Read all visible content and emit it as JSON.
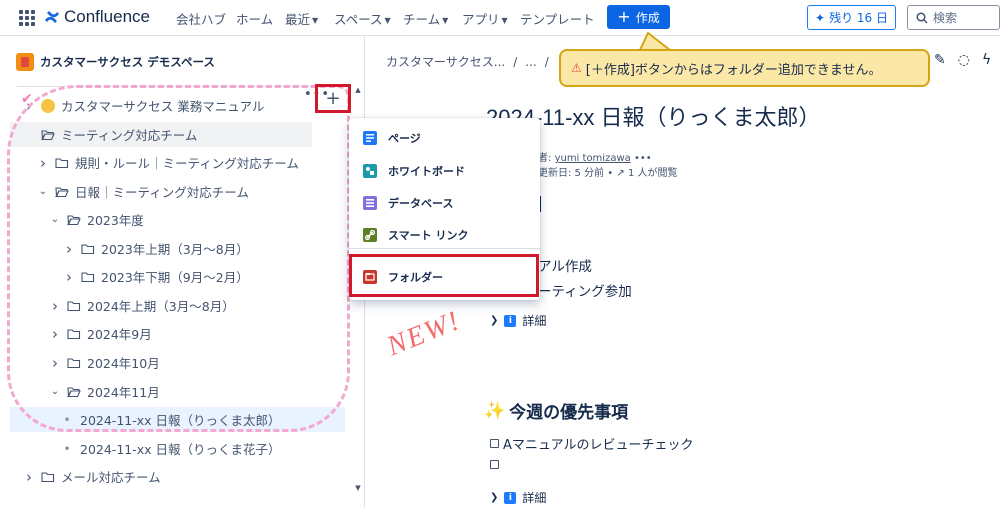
{
  "topnav": {
    "brand": "Confluence",
    "items": [
      {
        "label": "会社ハブ",
        "has_chevron": false
      },
      {
        "label": "ホーム",
        "has_chevron": false
      },
      {
        "label": "最近",
        "has_chevron": true
      },
      {
        "label": "スペース",
        "has_chevron": true
      },
      {
        "label": "チーム",
        "has_chevron": true
      },
      {
        "label": "アプリ",
        "has_chevron": true
      },
      {
        "label": "テンプレート",
        "has_chevron": false
      }
    ],
    "create_label": "作成",
    "trial_label": "残り 16 日",
    "search_placeholder": "検索",
    "accent_color": "#0c66e4"
  },
  "sidebar": {
    "space_name": "カスタマーサクセス デモスペース",
    "tree": [
      {
        "label": "カスタマーサクセス 業務マニュアル",
        "type": "page-emoji",
        "chevron": "›"
      },
      {
        "label": "ミーティング対応チーム",
        "type": "folder-open",
        "chevron": "✓",
        "state": "hover"
      },
      {
        "label": "規則・ルール｜ミーティング対応チーム",
        "type": "folder",
        "chevron": "›"
      },
      {
        "label": "日報｜ミーティング対応チーム",
        "type": "folder-open",
        "chevron": "⌄"
      },
      {
        "label": "2023年度",
        "type": "folder-open",
        "chevron": "⌄"
      },
      {
        "label": "2023年上期（3月～8月）",
        "type": "folder",
        "chevron": "›"
      },
      {
        "label": "2023年下期（9月～2月）",
        "type": "folder",
        "chevron": "›"
      },
      {
        "label": "2024年上期（3月～8月）",
        "type": "folder",
        "chevron": "›"
      },
      {
        "label": "2024年9月",
        "type": "folder",
        "chevron": "›"
      },
      {
        "label": "2024年10月",
        "type": "folder",
        "chevron": "›"
      },
      {
        "label": "2024年11月",
        "type": "folder-open",
        "chevron": "⌄"
      },
      {
        "label": "2024-11-xx 日報（りっくま太郎）",
        "type": "page",
        "chevron": "",
        "state": "selected"
      },
      {
        "label": "2024-11-xx 日報（りっくま花子）",
        "type": "page",
        "chevron": ""
      },
      {
        "label": "メール対応チーム",
        "type": "folder",
        "chevron": "›"
      }
    ],
    "more_label": "•••",
    "plus_label": "+"
  },
  "dropdown": {
    "items": [
      {
        "label": "ページ",
        "icon": "page-icon",
        "color": "#1d7afc"
      },
      {
        "label": "ホワイトボード",
        "icon": "whiteboard-icon",
        "color": "#1d9aaa"
      },
      {
        "label": "データベース",
        "icon": "database-icon",
        "color": "#8270db"
      },
      {
        "label": "スマート リンク",
        "icon": "smart-link-icon",
        "color": "#5b7f24"
      },
      {
        "label": "フォルダー",
        "icon": "folder-icon",
        "color": "#c9372c"
      }
    ]
  },
  "main": {
    "breadcrumb": [
      "カスタマーサクセス...",
      "...",
      ""
    ],
    "title": "2024-11-xx 日報（りっくま太郎）",
    "byline_prefix": "者: ",
    "byline_author": "yumi tomizawa",
    "byline_more": "•••",
    "meta_updated": "更新日: 5 分前 •",
    "meta_views": "1 人が閲覧",
    "lines": [
      "アル作成",
      "ーティング参加"
    ],
    "details_label": "詳細",
    "priority_heading": "今週の優先事項",
    "tasks": [
      "Aマニュアルのレビューチェック",
      ""
    ],
    "new_stamp": "NEW!"
  },
  "callout": {
    "text": "[＋作成]ボタンからはフォルダー追加できません。",
    "bg_color": "#fce8a6",
    "border_color": "#d5a412"
  }
}
